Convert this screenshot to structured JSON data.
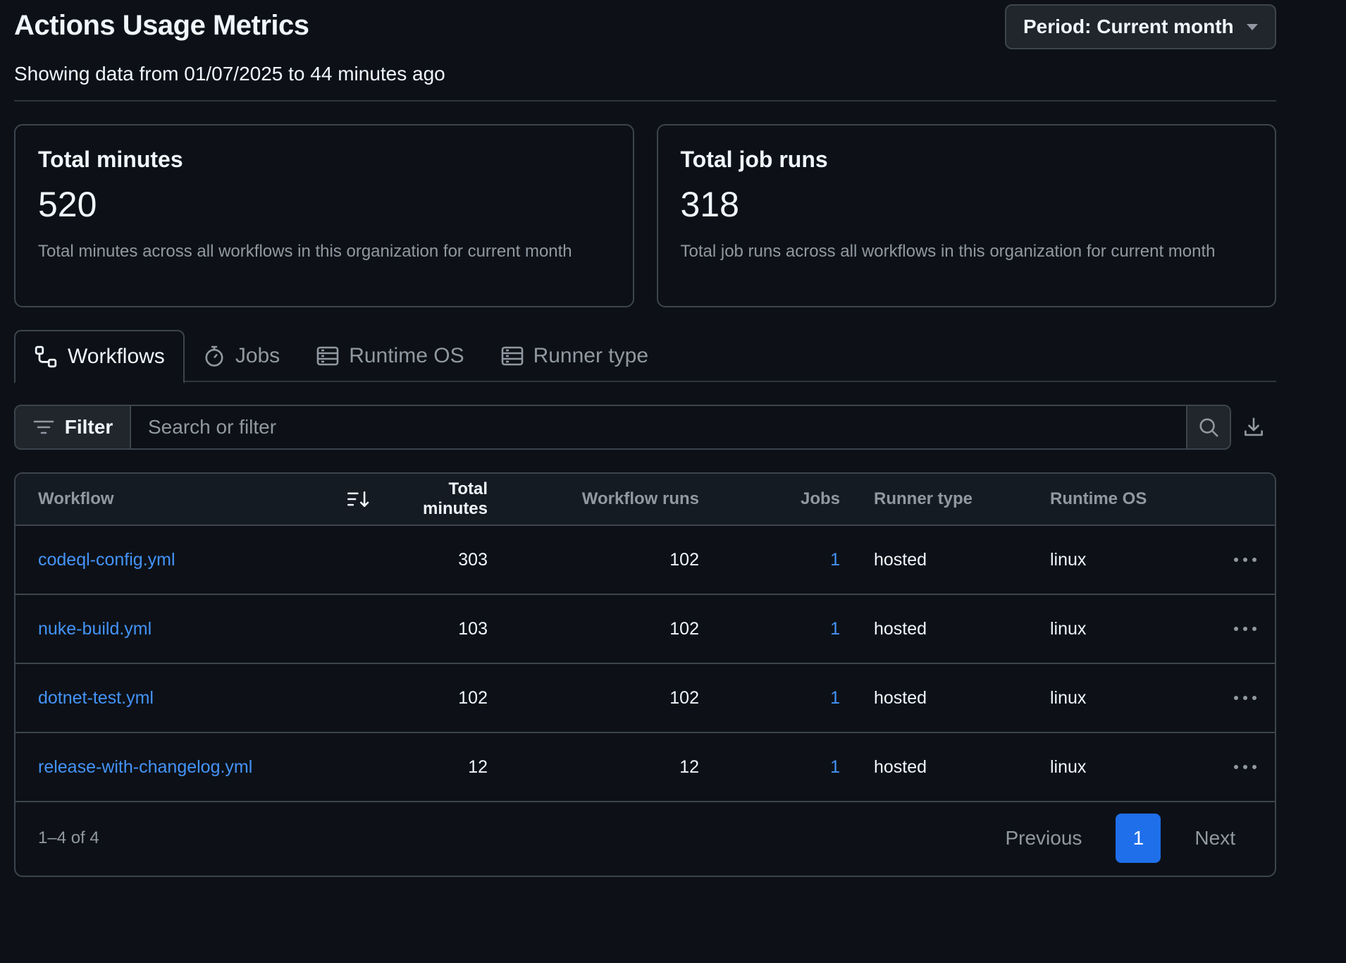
{
  "header": {
    "title": "Actions Usage Metrics",
    "subtitle": "Showing data from 01/07/2025 to 44 minutes ago",
    "period_label": "Period: Current month"
  },
  "cards": [
    {
      "title": "Total minutes",
      "value": "520",
      "description": "Total minutes across all workflows in this organization for current month"
    },
    {
      "title": "Total job runs",
      "value": "318",
      "description": "Total job runs across all workflows in this organization for current month"
    }
  ],
  "tabs": [
    {
      "label": "Workflows",
      "icon": "workflow-icon",
      "active": true
    },
    {
      "label": "Jobs",
      "icon": "stopwatch-icon",
      "active": false
    },
    {
      "label": "Runtime OS",
      "icon": "server-icon",
      "active": false
    },
    {
      "label": "Runner type",
      "icon": "server-icon",
      "active": false
    }
  ],
  "filter": {
    "button_label": "Filter",
    "placeholder": "Search or filter"
  },
  "table": {
    "columns": [
      "Workflow",
      "Total minutes",
      "Workflow runs",
      "Jobs",
      "Runner type",
      "Runtime OS"
    ],
    "sorted_column": "Total minutes",
    "rows": [
      {
        "workflow": "codeql-config.yml",
        "minutes": "303",
        "runs": "102",
        "jobs": "1",
        "runner": "hosted",
        "os": "linux"
      },
      {
        "workflow": "nuke-build.yml",
        "minutes": "103",
        "runs": "102",
        "jobs": "1",
        "runner": "hosted",
        "os": "linux"
      },
      {
        "workflow": "dotnet-test.yml",
        "minutes": "102",
        "runs": "102",
        "jobs": "1",
        "runner": "hosted",
        "os": "linux"
      },
      {
        "workflow": "release-with-changelog.yml",
        "minutes": "12",
        "runs": "12",
        "jobs": "1",
        "runner": "hosted",
        "os": "linux"
      }
    ]
  },
  "pagination": {
    "range": "1–4 of 4",
    "previous": "Previous",
    "current": "1",
    "next": "Next"
  },
  "colors": {
    "background": "#0d1117",
    "link": "#4493f8",
    "accent": "#1f6feb",
    "border": "#3d444d",
    "muted_text": "#9198a1"
  }
}
